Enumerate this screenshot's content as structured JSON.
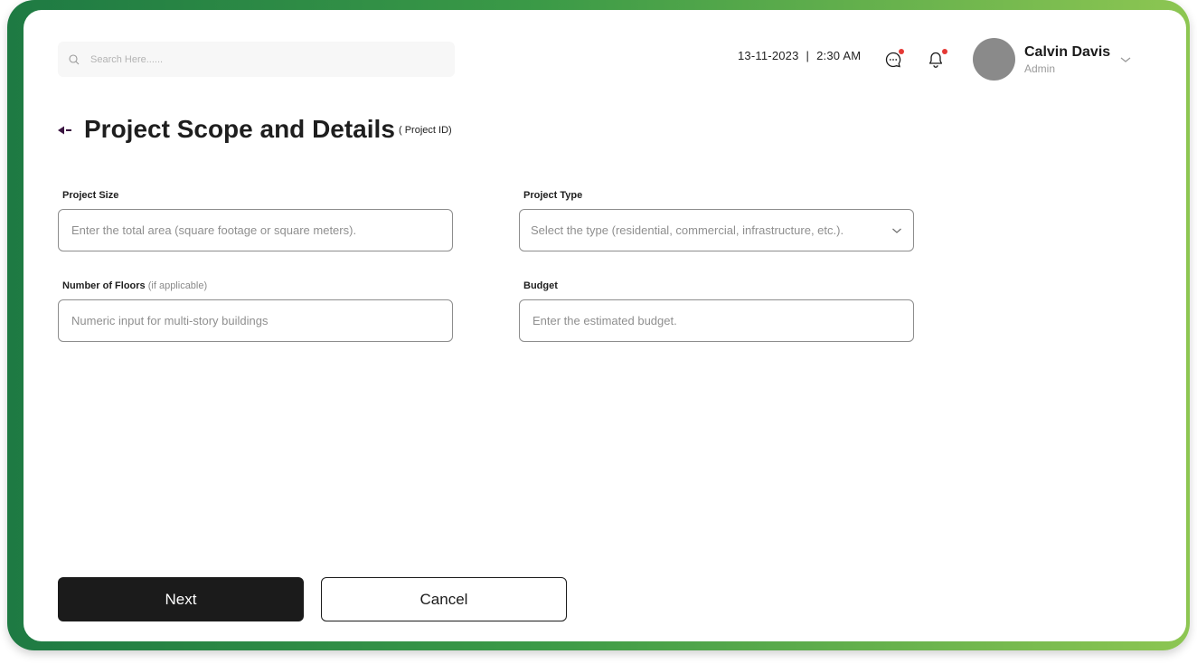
{
  "header": {
    "search_placeholder": "Search Here......",
    "date": "13-11-2023",
    "separator": "|",
    "time": "2:30 AM",
    "user_name": "Calvin Davis",
    "user_role": "Admin",
    "icons": [
      "search-icon",
      "chat-icon",
      "bell-icon",
      "chevron-down-icon"
    ],
    "notification_dot_color": "#e53935"
  },
  "page": {
    "title": "Project Scope and Details",
    "subtitle": "( Project ID)"
  },
  "form": {
    "project_size": {
      "label": "Project Size",
      "placeholder": "Enter the total area (square footage or square meters)."
    },
    "project_type": {
      "label": "Project Type",
      "placeholder": "Select the type (residential, commercial, infrastructure, etc.)."
    },
    "floors": {
      "label": "Number of Floors",
      "hint": "(if applicable)",
      "placeholder": "Numeric input for multi-story buildings"
    },
    "budget": {
      "label": "Budget",
      "placeholder": "Enter the estimated budget."
    }
  },
  "actions": {
    "next_label": "Next",
    "cancel_label": "Cancel"
  },
  "colors": {
    "frame_start": "#1e7a43",
    "frame_end": "#8dc652",
    "primary_button": "#1b1b1b"
  }
}
